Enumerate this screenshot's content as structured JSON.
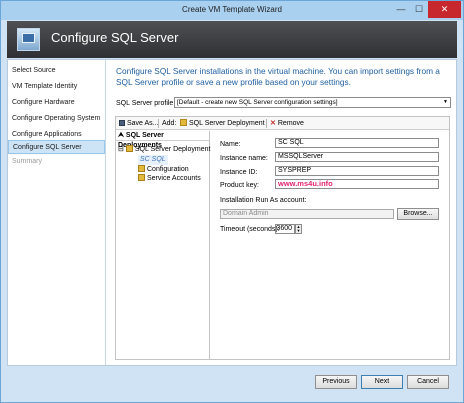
{
  "window": {
    "title": "Create VM Template Wizard",
    "min_glyph": "—",
    "max_glyph": "☐",
    "close_glyph": "✕"
  },
  "banner": {
    "title": "Configure SQL Server",
    "icon": "wizard-computer-icon"
  },
  "steps": [
    {
      "label": "Select Source",
      "state": "normal"
    },
    {
      "label": "VM Template Identity",
      "state": "normal"
    },
    {
      "label": "Configure Hardware",
      "state": "normal"
    },
    {
      "label": "Configure Operating System",
      "state": "normal"
    },
    {
      "label": "Configure Applications",
      "state": "normal"
    },
    {
      "label": "Configure SQL Server",
      "state": "active"
    },
    {
      "label": "Summary",
      "state": "disabled"
    }
  ],
  "main": {
    "heading": "Configure SQL Server installations in the virtual machine. You can import settings from a SQL Server profile or save a new profile based on your settings.",
    "profile_label": "SQL Server profile:",
    "profile_value": "[Default - create new SQL Server configuration settings]"
  },
  "toolbar": {
    "save_as": "Save As...",
    "add": "Add:",
    "sql_deployment": "SQL Server Deployment",
    "remove": "Remove",
    "remove_glyph": "✕"
  },
  "tree": {
    "header": "SQL Server Deployments",
    "collapse_glyph": "⮝",
    "root": "SQL Server Deployment",
    "root_toggle": "⊟",
    "selected": "SC SQL",
    "children": [
      "Configuration",
      "Service Accounts"
    ]
  },
  "form": {
    "name_label": "Name:",
    "name_value": "SC SQL",
    "instance_name_label": "Instance name:",
    "instance_name_value": "MSSQLServer",
    "instance_id_label": "Instance ID:",
    "instance_id_value": "SYSPREP",
    "product_key_label": "Product key:",
    "product_key_watermark": "www.ms4u.info",
    "runas_label": "Installation Run As account:",
    "runas_value": "Domain Admin",
    "browse": "Browse...",
    "timeout_label": "Timeout (seconds):",
    "timeout_value": "3600",
    "spin_up": "▲",
    "spin_down": "▼"
  },
  "footer": {
    "previous": "Previous",
    "next": "Next",
    "cancel": "Cancel"
  },
  "colors": {
    "heading": "#1f5fa0",
    "active_step": "#cde4f7",
    "close_button": "#c7282d",
    "watermark": "#e2246e"
  }
}
